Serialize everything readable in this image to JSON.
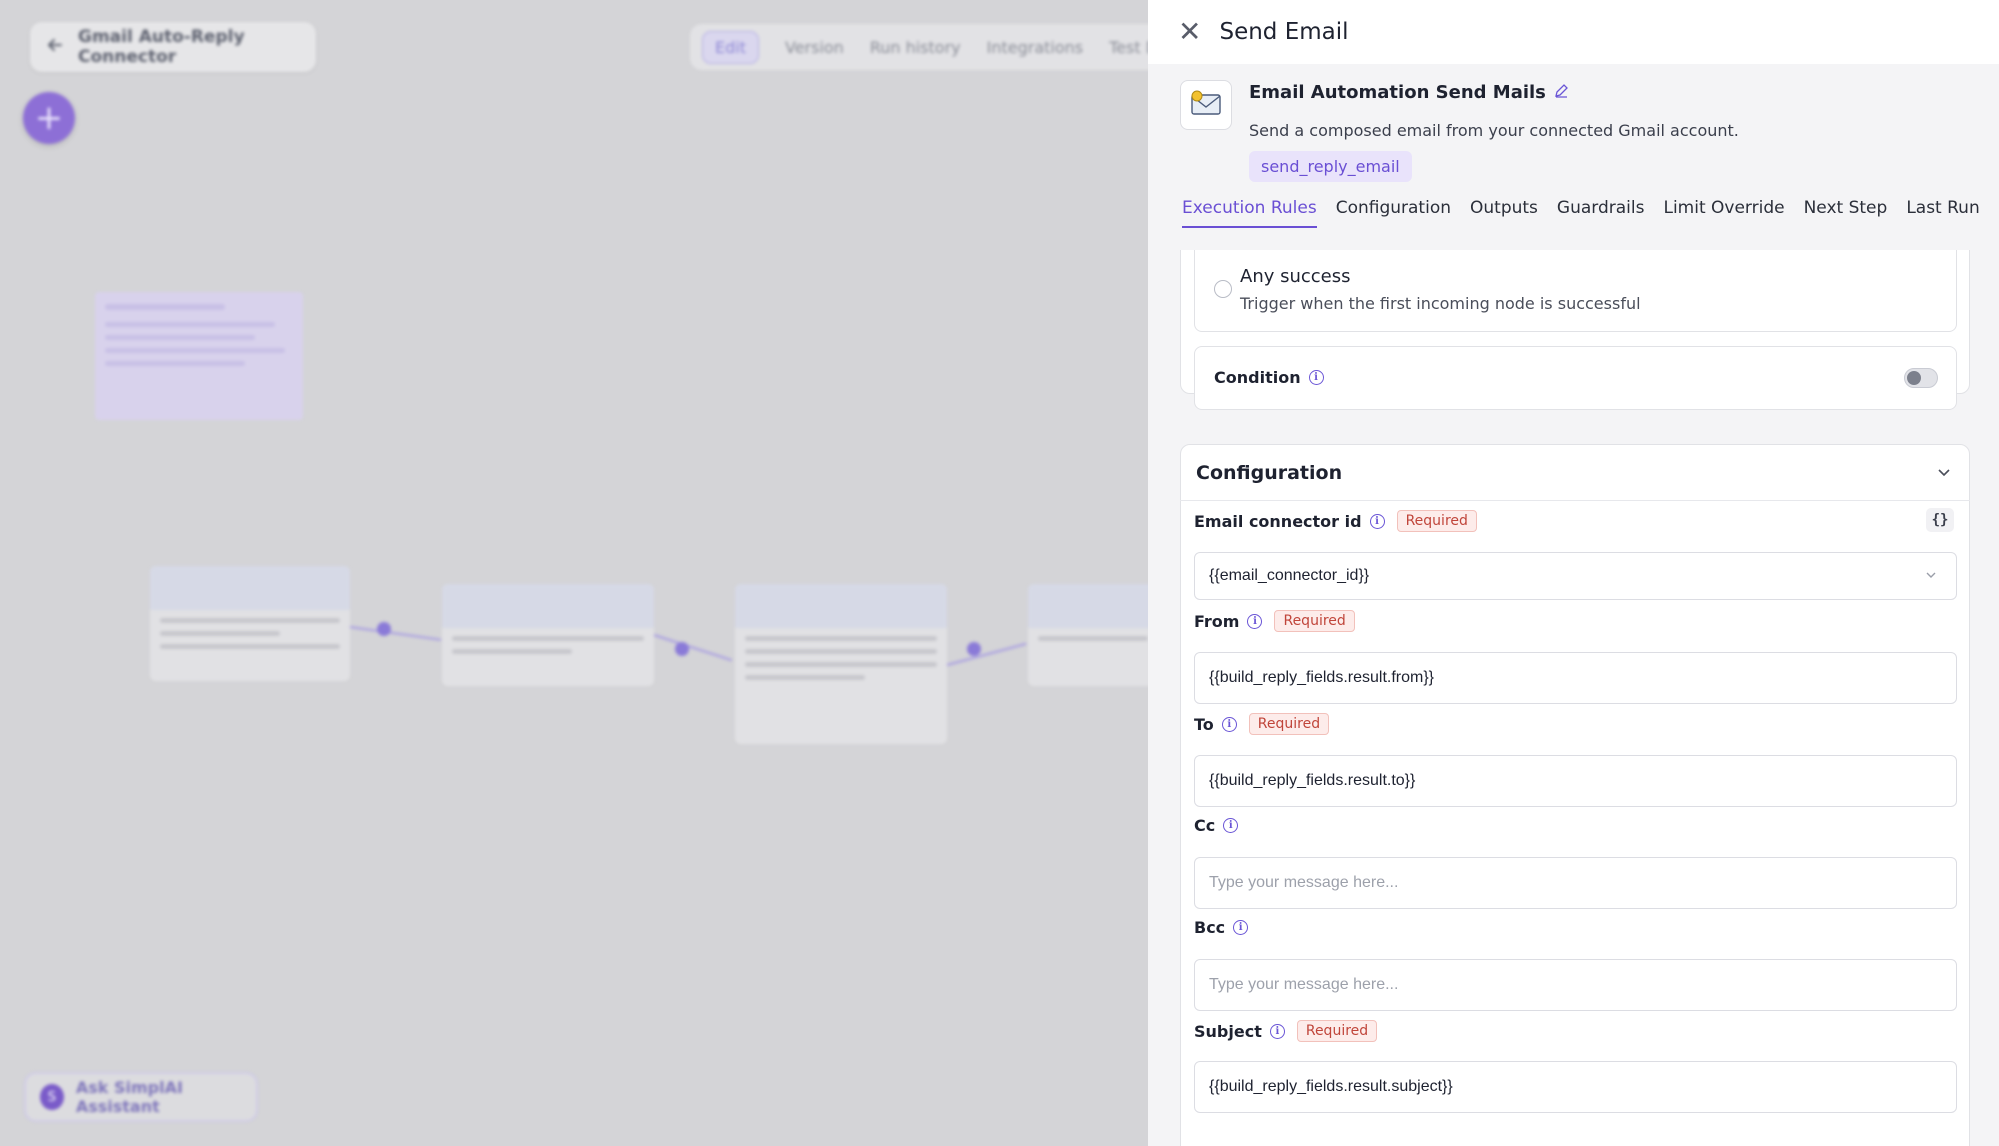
{
  "canvas": {
    "workflow_title": "Gmail Auto-Reply Connector",
    "tabs": [
      "Edit",
      "Version",
      "Run history",
      "Integrations",
      "Test Da"
    ],
    "assistant_label": "Ask SimplAI Assistant",
    "add_symbol": "+",
    "assistant_symbol": "S"
  },
  "panel": {
    "title": "Send Email",
    "close_symbol": "✕",
    "node": {
      "name": "Email Automation Send Mails",
      "description": "Send a composed email from your connected Gmail account.",
      "tag": "send_reply_email",
      "icon": "envelope-icon"
    },
    "tabs": [
      "Execution Rules",
      "Configuration",
      "Outputs",
      "Guardrails",
      "Limit Override",
      "Next Step",
      "Last Run"
    ],
    "active_tab": "Execution Rules",
    "execution": {
      "option_title": "Any success",
      "option_description": "Trigger when the first incoming node is successful",
      "condition_label": "Condition",
      "condition_enabled": false
    },
    "configuration": {
      "heading": "Configuration",
      "required_label": "Required",
      "braces_label": "{}",
      "fields": {
        "email_connector_id": {
          "label": "Email connector id",
          "value": "{{email_connector_id}}"
        },
        "from": {
          "label": "From",
          "value": "{{build_reply_fields.result.from}}"
        },
        "to": {
          "label": "To",
          "value": "{{build_reply_fields.result.to}}"
        },
        "cc": {
          "label": "Cc",
          "placeholder": "Type your message here..."
        },
        "bcc": {
          "label": "Bcc",
          "placeholder": "Type your message here..."
        },
        "subject": {
          "label": "Subject",
          "value": "{{build_reply_fields.result.subject}}"
        }
      }
    }
  }
}
